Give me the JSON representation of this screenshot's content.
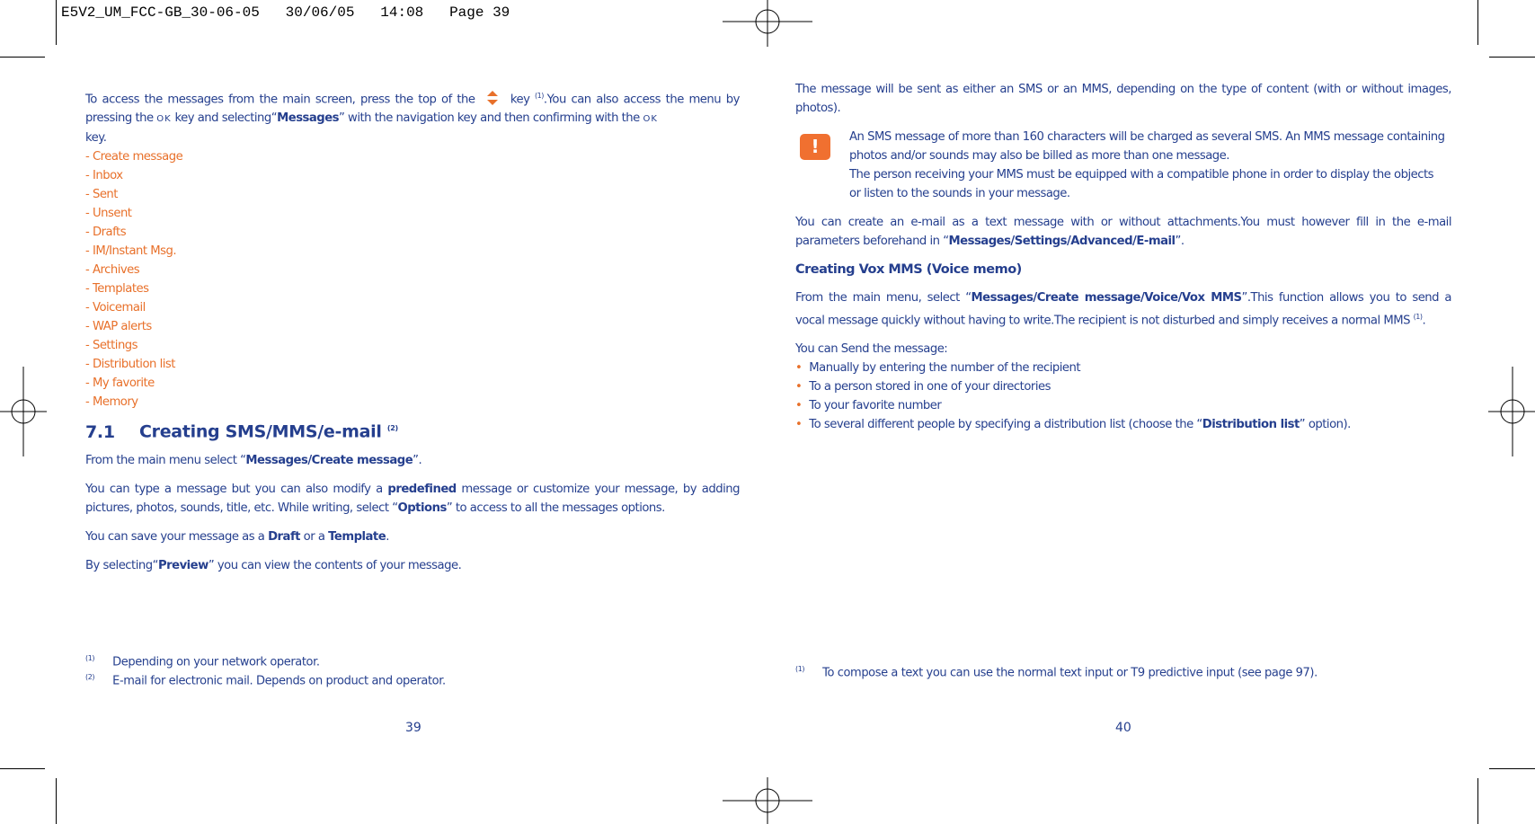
{
  "header": "E5V2_UM_FCC-GB_30-06-05   30/06/05   14:08   Page 39",
  "left": {
    "intro": {
      "a": "To access the messages from the main screen, press the top of the",
      "b": "key",
      "sup": "(1)",
      "c": ".You can also access the menu by pressing the",
      "ok": "OK",
      "d": "key and selecting“",
      "bold": "Messages",
      "e": "” with the navigation key and then confirming with the",
      "f": "key."
    },
    "menu": [
      "- Create message",
      "- Inbox",
      "- Sent",
      "- Unsent",
      "- Drafts",
      "- IM/Instant Msg.",
      "- Archives",
      "- Templates",
      "- Voicemail",
      "- WAP alerts",
      "- Settings",
      "- Distribution list",
      "- My favorite",
      "- Memory"
    ],
    "section": {
      "number": "7.1",
      "title": "Creating SMS/MMS/e-mail",
      "sup": "(2)"
    },
    "p1": {
      "a": "From the main menu select “",
      "bold": "Messages/Create message",
      "b": "”."
    },
    "p2": {
      "a": "You can type a message but you can also modify a ",
      "bold1": "predefined",
      "b": " message or customize your message, by adding pictures, photos, sounds, title, etc. While writing, select “",
      "bold2": "Options",
      "c": "” to access to all the messages options."
    },
    "p3": {
      "a": "You can save your message as a ",
      "bold1": "Draft",
      "b": " or a ",
      "bold2": "Template",
      "c": "."
    },
    "p4": {
      "a": "By selecting“",
      "bold": "Preview",
      "b": "” you can view the contents of your message."
    },
    "footnotes": [
      {
        "mark": "(1)",
        "text": "Depending on your network operator."
      },
      {
        "mark": "(2)",
        "text": "E-mail for electronic mail. Depends on product and operator."
      }
    ],
    "page": "39"
  },
  "right": {
    "p1": "The message will be sent as either an SMS or an MMS, depending on the type of content (with or without images, photos).",
    "warning_icon": "!",
    "warn1": "An SMS message of more than 160 characters will be charged as several SMS. An MMS message containing photos and/or sounds may also be billed as more than one message.",
    "warn2": "The person receiving your MMS must be equipped with a compatible phone in order to display the objects or listen to the sounds in your message.",
    "p2": {
      "a": "You can create an e-mail as a text message with or without attachments.You must however fill in the e-mail parameters beforehand in “",
      "bold": "Messages/Settings/Advanced/E-mail",
      "b": "”."
    },
    "heading": "Creating Vox MMS (Voice memo)",
    "p3": {
      "a": "From the main menu, select “",
      "bold": "Messages/Create message/Voice/Vox MMS",
      "b": "”.This function allows you to send a vocal message quickly without having to write.The recipient is not disturbed and simply receives a normal MMS ",
      "sup": "(1)",
      "c": "."
    },
    "p4": "You can Send the message:",
    "bullets": [
      "Manually by entering the number of the recipient",
      "To a person stored in one of your directories",
      "To your favorite number"
    ],
    "bullet4": {
      "a": "To several different people by specifying a distribution list (choose the “",
      "bold": "Distribution list",
      "b": "” option)."
    },
    "footnote": {
      "mark": "(1)",
      "text": "To compose a text you can use the normal text input or T9 predictive input (see page 97)."
    },
    "page": "40"
  },
  "colors": {
    "text": "#253f8e",
    "accent": "#e8702a"
  }
}
